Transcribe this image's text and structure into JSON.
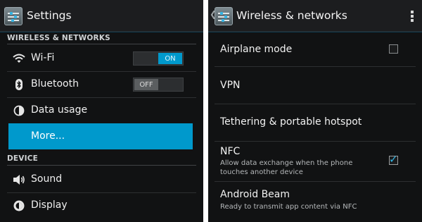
{
  "left": {
    "actionbar": {
      "title": "Settings",
      "icon": "settings-app-icon"
    },
    "sections": [
      {
        "header": "WIRELESS & NETWORKS"
      },
      {
        "header": "DEVICE"
      }
    ],
    "items": {
      "wifi": {
        "label": "Wi-Fi",
        "icon": "wifi-icon",
        "toggle": "ON"
      },
      "bluetooth": {
        "label": "Bluetooth",
        "icon": "bluetooth-icon",
        "toggle": "OFF"
      },
      "data_usage": {
        "label": "Data usage",
        "icon": "data-usage-icon"
      },
      "more": {
        "label": "More..."
      },
      "sound": {
        "label": "Sound",
        "icon": "speaker-icon"
      },
      "display": {
        "label": "Display",
        "icon": "brightness-icon"
      }
    }
  },
  "right": {
    "actionbar": {
      "title": "Wireless & networks",
      "icon": "settings-app-icon",
      "overflow": "overflow-menu-icon"
    },
    "items": {
      "airplane": {
        "title": "Airplane mode",
        "checked": false
      },
      "vpn": {
        "title": "VPN"
      },
      "tethering": {
        "title": "Tethering & portable hotspot"
      },
      "nfc": {
        "title": "NFC",
        "summary": "Allow data exchange when the phone touches another device",
        "checked": true
      },
      "beam": {
        "title": "Android Beam",
        "summary": "Ready to transmit app content via NFC"
      }
    }
  },
  "colors": {
    "accent": "#0099cc",
    "holo_blue": "#33b5e5",
    "background": "#111213"
  }
}
